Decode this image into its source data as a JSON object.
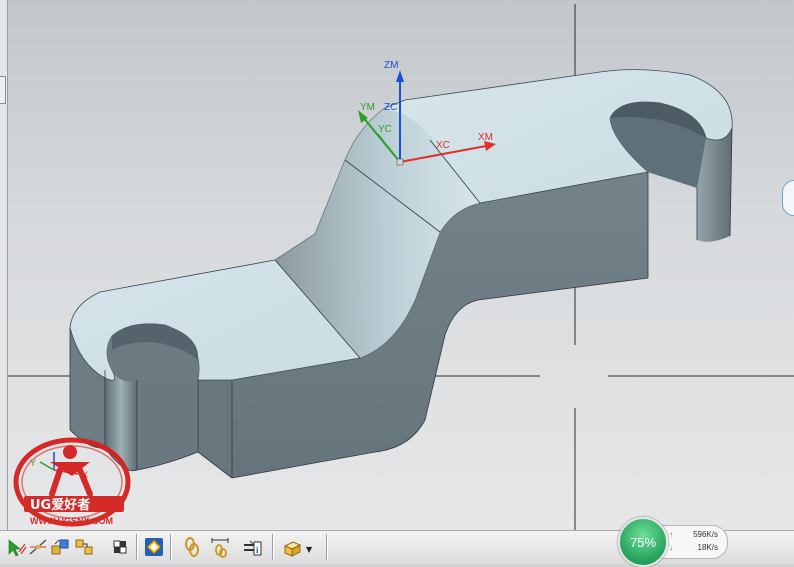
{
  "viewport": {
    "axes": {
      "zm": "ZM",
      "zc": "ZC",
      "ym": "YM",
      "yc": "YC",
      "xm": "XM",
      "xc": "XC"
    },
    "view_triad": {
      "y": "Y",
      "x": "X"
    },
    "colors": {
      "x_axis": "#e0302a",
      "y_axis": "#2aa02a",
      "z_axis": "#1a4fd6",
      "part_top": "#cfe0e6",
      "part_side": "#6f7d84"
    }
  },
  "watermark": {
    "brand": "UG爱好者",
    "url": "WWW.UGSNX.COM"
  },
  "toolbar": {
    "icons": [
      "select-filter-icon",
      "snap-point-icon",
      "part-navigator-icon",
      "assembly-icon",
      "view-orient-icon",
      "chain-link-icon",
      "measure-icon",
      "info-icon",
      "display-mode-icon"
    ]
  },
  "network": {
    "percent": "75%",
    "upload": "596K/s",
    "download": "18K/s"
  }
}
